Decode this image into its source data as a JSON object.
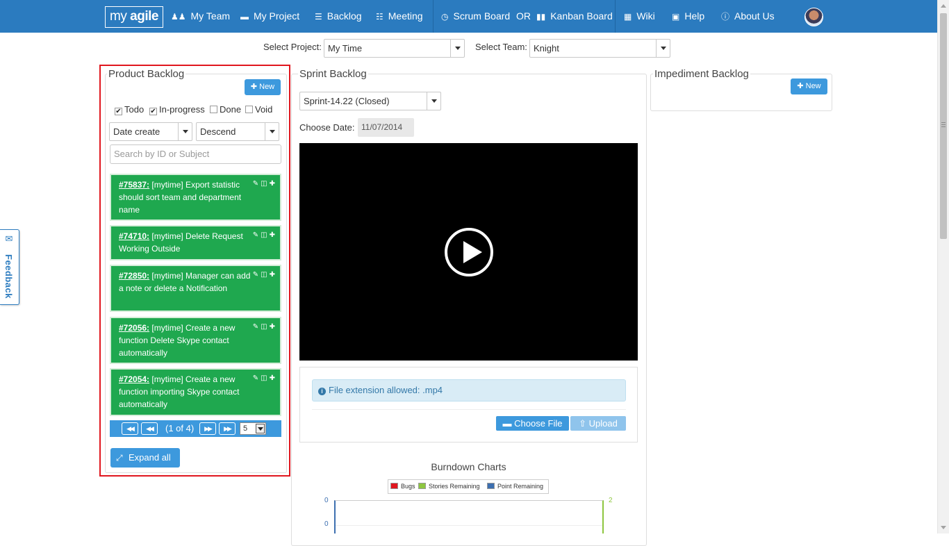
{
  "nav": {
    "logo_prefix": "my",
    "logo_bold": "agile",
    "items": [
      {
        "label": "My Team",
        "icon": "users-icon"
      },
      {
        "label": "My Project",
        "icon": "folder-icon"
      },
      {
        "label": "Backlog",
        "icon": "list-icon"
      },
      {
        "label": "Meeting",
        "icon": "sitemap-icon"
      },
      {
        "label": "Scrum Board",
        "icon": "clock-icon"
      },
      {
        "label": "Kanban Board",
        "icon": "columns-icon"
      },
      {
        "label": "Wiki",
        "icon": "grid-icon"
      },
      {
        "label": "Help",
        "icon": "book-icon"
      },
      {
        "label": "About Us",
        "icon": "info-icon"
      }
    ],
    "or_text": "OR"
  },
  "selectors": {
    "project_label": "Select Project:",
    "project_value": "My Time",
    "team_label": "Select Team:",
    "team_value": "Knight"
  },
  "product_backlog": {
    "title": "Product Backlog",
    "new_label": "New",
    "filters": [
      {
        "label": "Todo",
        "checked": true
      },
      {
        "label": "In-progress",
        "checked": true
      },
      {
        "label": "Done",
        "checked": false
      },
      {
        "label": "Void",
        "checked": false
      }
    ],
    "sort_field": "Date create",
    "sort_order": "Descend",
    "search_placeholder": "Search by ID or Subject",
    "items": [
      {
        "id": "#75837:",
        "text": "[mytime] Export statistic should sort team and department name"
      },
      {
        "id": "#74710:",
        "text": "[mytime] Delete Request Working Outside"
      },
      {
        "id": "#72850:",
        "text": "[mytime] Manager can add a note or delete a Notification"
      },
      {
        "id": "#72056:",
        "text": "[mytime] Create a new function Delete Skype contact automatically"
      },
      {
        "id": "#72054:",
        "text": "[mytime] Create a new function importing Skype contact automatically"
      }
    ],
    "pager_info": "(1 of 4)",
    "page_size": "5",
    "expand_label": "Expand all"
  },
  "sprint_backlog": {
    "title": "Sprint Backlog",
    "sprint_value": "Sprint-14.22 (Closed)",
    "date_label": "Choose Date:",
    "date_value": "11/07/2014",
    "info_text": "File extension allowed: .mp4",
    "choose_file_label": "Choose File",
    "upload_label": "Upload"
  },
  "impediment_backlog": {
    "title": "Impediment Backlog",
    "new_label": "New"
  },
  "chart_data": {
    "type": "line",
    "title": "Burndown Charts",
    "legend": [
      "Bugs",
      "Stories Remaining",
      "Point Remaining"
    ],
    "legend_colors": [
      "#e0161e",
      "#8dc63f",
      "#3d6fb0"
    ],
    "series": [
      {
        "name": "Bugs",
        "values": []
      },
      {
        "name": "Stories Remaining",
        "values": []
      },
      {
        "name": "Point Remaining",
        "values": []
      }
    ],
    "left_ticks": [
      "0",
      "0"
    ],
    "right_ticks": [
      "2"
    ]
  },
  "feedback": {
    "label": "Feedback"
  }
}
